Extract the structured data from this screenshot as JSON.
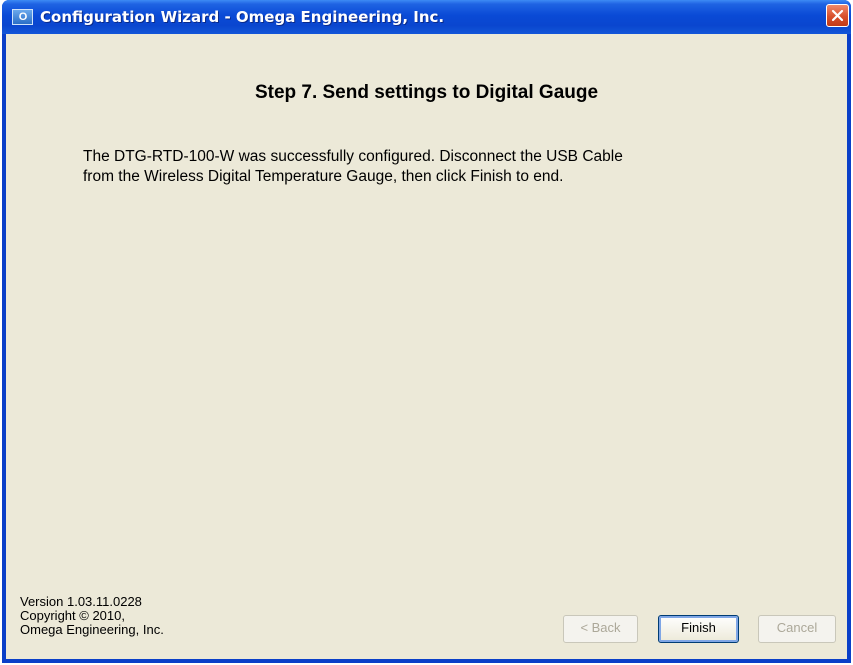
{
  "window": {
    "icon_text": "O",
    "title": "Configuration Wizard - Omega Engineering, Inc."
  },
  "content": {
    "step_title": "Step 7.  Send settings to Digital Gauge",
    "message_line1": "The DTG-RTD-100-W was successfully configured.  Disconnect the USB Cable",
    "message_line2": "from the Wireless Digital Temperature Gauge, then click Finish to end."
  },
  "footer": {
    "version": "Version 1.03.11.0228",
    "copyright": "Copyright © 2010,",
    "company": "Omega Engineering, Inc."
  },
  "buttons": {
    "back": "< Back",
    "finish": "Finish",
    "cancel": "Cancel"
  },
  "colors": {
    "titlebar": "#0a4ad6",
    "client_background": "#ece9d8",
    "close_button": "#d8502c"
  }
}
